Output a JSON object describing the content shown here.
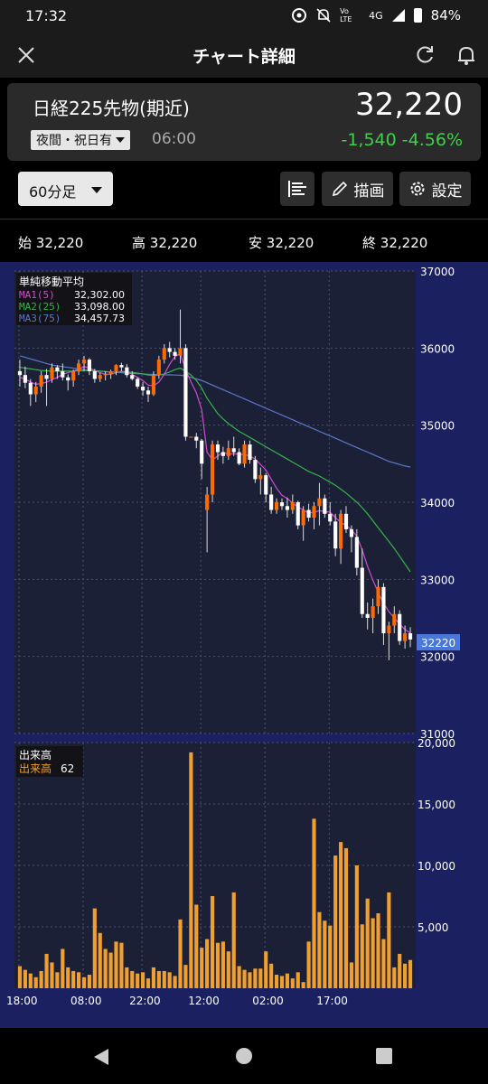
{
  "status_bar": {
    "time": "17:32",
    "network": "4G",
    "volte": "Vo LTE",
    "battery": "84%"
  },
  "header": {
    "title": "チャート詳細"
  },
  "quote": {
    "name": "日経225先物(期近)",
    "price": "32,220",
    "session": "夜間・祝日有",
    "session_time": "06:00",
    "change": "-1,540",
    "change_pct": "-4.56%",
    "up_color": "#ff6a00",
    "down_color": "#ffffff",
    "change_color": "#3fd04a"
  },
  "toolbar": {
    "interval": "60分足",
    "draw_label": "描画",
    "settings_label": "設定"
  },
  "ohlc": {
    "open_label": "始",
    "open": "32,220",
    "high_label": "高",
    "high": "32,220",
    "low_label": "安",
    "low": "32,220",
    "close_label": "終",
    "close": "32,220"
  },
  "indicator_legend": {
    "title": "単純移動平均",
    "ma1_label": "MA1(5)",
    "ma1_value": "32,302.00",
    "ma1_color": "#d24bd2",
    "ma2_label": "MA2(25)",
    "ma2_value": "33,098.00",
    "ma2_color": "#35b548",
    "ma3_label": "MA3(75)",
    "ma3_value": "34,457.73",
    "ma3_color": "#5a78c8"
  },
  "volume_legend": {
    "title": "出来高",
    "label": "出来高",
    "value": "62",
    "color": "#f0a030"
  },
  "chart_data": {
    "type": "candlestick",
    "price_axis": {
      "min": 31000,
      "max": 37000,
      "ticks": [
        "37000",
        "36000",
        "35000",
        "34000",
        "33000",
        "32000",
        "31000"
      ]
    },
    "price_tag": "32220",
    "volume_axis": {
      "min": 0,
      "max": 20000,
      "ticks": [
        "20,000",
        "15,000",
        "10,000",
        "5,000"
      ]
    },
    "time_labels": [
      "18:00",
      "08:00",
      "22:00",
      "12:00",
      "02:00",
      "17:00"
    ],
    "candles": [
      [
        35700,
        35850,
        35500,
        35650
      ],
      [
        35650,
        35760,
        35480,
        35550
      ],
      [
        35550,
        35600,
        35250,
        35400
      ],
      [
        35400,
        35560,
        35300,
        35500
      ],
      [
        35500,
        35700,
        35420,
        35650
      ],
      [
        35650,
        35730,
        35250,
        35600
      ],
      [
        35600,
        35800,
        35550,
        35750
      ],
      [
        35750,
        35780,
        35600,
        35700
      ],
      [
        35700,
        35800,
        35580,
        35620
      ],
      [
        35620,
        35660,
        35450,
        35580
      ],
      [
        35580,
        35720,
        35500,
        35700
      ],
      [
        35700,
        35850,
        35650,
        35800
      ],
      [
        35800,
        35900,
        35700,
        35850
      ],
      [
        35850,
        35870,
        35650,
        35700
      ],
      [
        35700,
        35730,
        35550,
        35600
      ],
      [
        35600,
        35680,
        35560,
        35650
      ],
      [
        35650,
        35700,
        35580,
        35660
      ],
      [
        35660,
        35720,
        35600,
        35700
      ],
      [
        35700,
        35790,
        35650,
        35780
      ],
      [
        35780,
        35810,
        35700,
        35750
      ],
      [
        35750,
        35790,
        35620,
        35650
      ],
      [
        35650,
        35700,
        35580,
        35600
      ],
      [
        35600,
        35620,
        35470,
        35500
      ],
      [
        35500,
        35560,
        35380,
        35450
      ],
      [
        35450,
        35500,
        35300,
        35400
      ],
      [
        35400,
        35700,
        35380,
        35650
      ],
      [
        35650,
        35900,
        35600,
        35850
      ],
      [
        35850,
        36050,
        35800,
        36000
      ],
      [
        36000,
        36080,
        35880,
        35950
      ],
      [
        35950,
        36000,
        35850,
        35900
      ],
      [
        35900,
        36500,
        35800,
        36000
      ],
      [
        36000,
        36050,
        34800,
        34850
      ],
      [
        34850,
        34850,
        34850,
        34850
      ],
      [
        34850,
        34900,
        34700,
        34800
      ],
      [
        34800,
        34820,
        34300,
        34500
      ],
      [
        33900,
        34200,
        33350,
        34100
      ],
      [
        34100,
        34800,
        34000,
        34750
      ],
      [
        34750,
        34800,
        34550,
        34650
      ],
      [
        34650,
        34720,
        34500,
        34600
      ],
      [
        34600,
        34800,
        34550,
        34700
      ],
      [
        34700,
        34850,
        34600,
        34650
      ],
      [
        34650,
        34700,
        34480,
        34500
      ],
      [
        34500,
        34800,
        34450,
        34750
      ],
      [
        34750,
        34800,
        34500,
        34550
      ],
      [
        34550,
        34600,
        34250,
        34300
      ],
      [
        34300,
        34450,
        34100,
        34350
      ],
      [
        34350,
        34380,
        34000,
        34100
      ],
      [
        34100,
        34200,
        33850,
        33900
      ],
      [
        33900,
        34050,
        33850,
        34000
      ],
      [
        34000,
        34050,
        33900,
        33950
      ],
      [
        33950,
        34060,
        33800,
        33900
      ],
      [
        33900,
        34100,
        33850,
        34000
      ],
      [
        34000,
        34020,
        33650,
        33700
      ],
      [
        33700,
        33950,
        33500,
        33900
      ],
      [
        33900,
        33980,
        33750,
        33800
      ],
      [
        33800,
        34000,
        33650,
        33950
      ],
      [
        33950,
        34250,
        33700,
        34050
      ],
      [
        34050,
        34100,
        33800,
        33850
      ],
      [
        33850,
        34000,
        33700,
        33750
      ],
      [
        33750,
        33850,
        33300,
        33400
      ],
      [
        33400,
        33900,
        33200,
        33850
      ],
      [
        33850,
        33950,
        33600,
        33650
      ],
      [
        33650,
        33700,
        33350,
        33550
      ],
      [
        33550,
        33650,
        33050,
        33150
      ],
      [
        33150,
        33400,
        32500,
        32550
      ],
      [
        32550,
        32700,
        32350,
        32500
      ],
      [
        32500,
        32750,
        32300,
        32650
      ],
      [
        32650,
        33000,
        32550,
        32900
      ],
      [
        32900,
        32950,
        32150,
        32300
      ],
      [
        32300,
        32450,
        31950,
        32400
      ],
      [
        32400,
        32650,
        32300,
        32550
      ],
      [
        32550,
        32600,
        32150,
        32200
      ],
      [
        32200,
        32400,
        32100,
        32300
      ],
      [
        32300,
        32380,
        32120,
        32220
      ]
    ],
    "ma1": [
      35620,
      35600,
      35560,
      35530,
      35540,
      35560,
      35590,
      35620,
      35660,
      35680,
      35700,
      35730,
      35760,
      35740,
      35710,
      35680,
      35660,
      35660,
      35680,
      35700,
      35690,
      35660,
      35620,
      35580,
      35520,
      35510,
      35560,
      35660,
      35790,
      35890,
      35930,
      35720,
      35560,
      35420,
      35200,
      34650,
      34550,
      34600,
      34650,
      34620,
      34630,
      34620,
      34620,
      34600,
      34560,
      34490,
      34420,
      34300,
      34180,
      34090,
      34050,
      33990,
      33940,
      33900,
      33860,
      33870,
      33890,
      33880,
      33870,
      33800,
      33740,
      33700,
      33640,
      33560,
      33380,
      33170,
      32990,
      32830,
      32690,
      32580,
      32500,
      32420,
      32350,
      32302
    ],
    "ma2": [
      35750,
      35740,
      35730,
      35720,
      35710,
      35705,
      35700,
      35700,
      35700,
      35700,
      35700,
      35705,
      35710,
      35710,
      35705,
      35700,
      35695,
      35690,
      35690,
      35690,
      35690,
      35685,
      35675,
      35665,
      35650,
      35645,
      35650,
      35665,
      35690,
      35720,
      35740,
      35700,
      35650,
      35580,
      35480,
      35350,
      35250,
      35150,
      35080,
      35020,
      34970,
      34920,
      34880,
      34840,
      34800,
      34760,
      34720,
      34680,
      34640,
      34600,
      34560,
      34520,
      34480,
      34440,
      34400,
      34370,
      34340,
      34300,
      34260,
      34220,
      34170,
      34120,
      34060,
      34000,
      33930,
      33850,
      33760,
      33670,
      33580,
      33490,
      33400,
      33300,
      33200,
      33098
    ],
    "ma3": [
      35900,
      35880,
      35860,
      35840,
      35820,
      35800,
      35780,
      35770,
      35760,
      35750,
      35740,
      35730,
      35720,
      35710,
      35705,
      35700,
      35695,
      35690,
      35685,
      35680,
      35676,
      35672,
      35668,
      35664,
      35660,
      35658,
      35656,
      35654,
      35652,
      35650,
      35648,
      35640,
      35620,
      35600,
      35580,
      35550,
      35520,
      35490,
      35460,
      35430,
      35400,
      35370,
      35340,
      35310,
      35280,
      35250,
      35220,
      35190,
      35160,
      35130,
      35100,
      35070,
      35040,
      35010,
      34980,
      34950,
      34920,
      34890,
      34860,
      34830,
      34800,
      34770,
      34740,
      34710,
      34680,
      34650,
      34620,
      34590,
      34560,
      34530,
      34510,
      34490,
      34470,
      34457
    ],
    "volume": [
      1800,
      1500,
      1200,
      900,
      1400,
      2800,
      2100,
      1300,
      3200,
      1700,
      1400,
      1300,
      900,
      1100,
      6500,
      4500,
      3200,
      2900,
      3800,
      3700,
      1700,
      1400,
      1200,
      1300,
      800,
      1700,
      1400,
      1400,
      1300,
      1000,
      5600,
      1900,
      19200,
      6800,
      3300,
      4000,
      7500,
      3700,
      3800,
      3000,
      7800,
      1800,
      1500,
      1300,
      1600,
      1600,
      3000,
      2000,
      1100,
      1000,
      1200,
      800,
      1300,
      500,
      3800,
      13800,
      6200,
      5500,
      5100,
      10800,
      11900,
      11400,
      2100,
      10000,
      5200,
      7300,
      5700,
      6100,
      4000,
      7800,
      1700,
      2800,
      2000,
      2300
    ]
  }
}
